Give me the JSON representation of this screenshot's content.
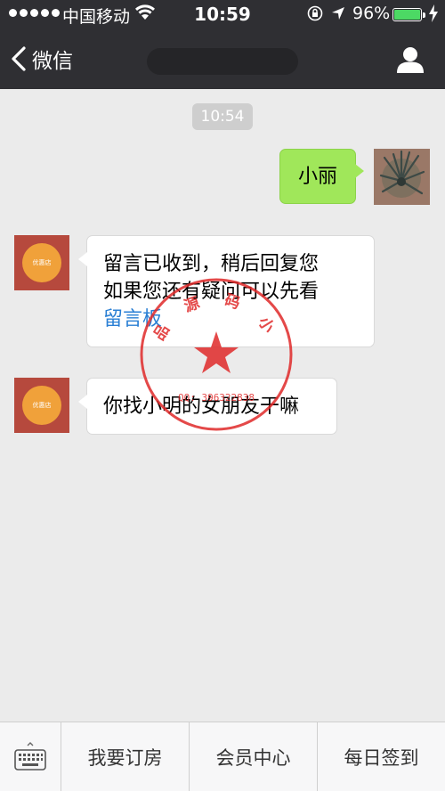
{
  "status_bar": {
    "carrier": "中国移动",
    "time": "10:59",
    "battery_percent": "96%",
    "battery_color": "#4cd964"
  },
  "nav": {
    "back_label": "微信"
  },
  "chat": {
    "timestamp": "10:54",
    "messages": [
      {
        "from": "me",
        "text": "小丽"
      },
      {
        "from": "shop",
        "line1": "留言已收到，稍后回复您",
        "line2": "如果您还有疑问可以先看",
        "link": "留言板"
      },
      {
        "from": "shop",
        "text": "你找小明的女朋友干嘛"
      }
    ],
    "shop_avatar_text": "优惠店"
  },
  "stamp": {
    "text": "精 品 源 码 小 店",
    "qq": "QQ: 396322838",
    "color": "#e02a2a"
  },
  "bottom_menu": {
    "items": [
      "我要订房",
      "会员中心",
      "每日签到"
    ]
  },
  "icons": {
    "back": "chevron-left-icon",
    "profile": "person-icon",
    "keyboard": "keyboard-icon"
  }
}
